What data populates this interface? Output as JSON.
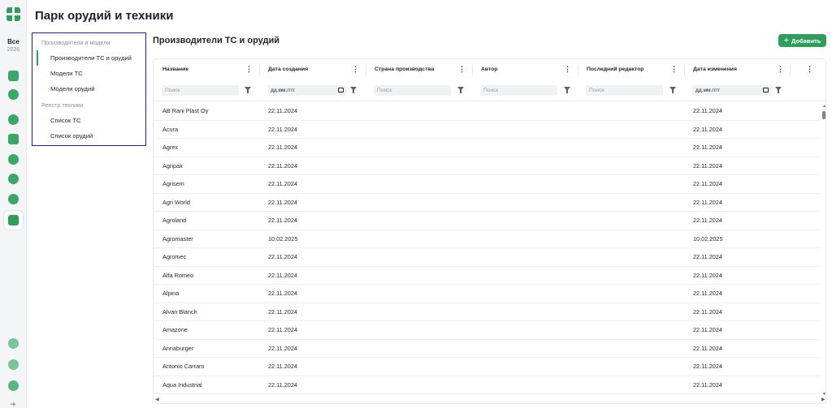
{
  "rail": {
    "year_all": "Все",
    "year": "2026",
    "icons": [
      "dashboard-icon",
      "layers-icon",
      "tractor-icon",
      "clipboard-icon",
      "leaf-icon",
      "sprout-icon",
      "pie-chart-icon",
      "machinery-park-icon",
      "settings-icon",
      "help-icon",
      "profile-icon",
      "logout-icon"
    ]
  },
  "page_title": "Парк орудий и техники",
  "nav": {
    "group1": "Производители и модели",
    "items1": [
      "Производители ТС и орудий",
      "Модели ТС",
      "Модели орудий"
    ],
    "group2": "Реестр техники",
    "items2": [
      "Список ТС",
      "Список орудий"
    ]
  },
  "section_title": "Производители ТС и орудий",
  "add_button": "Добавить",
  "table": {
    "columns": [
      "Название",
      "Дата создания",
      "Страна производства",
      "Автор",
      "Последний редактор",
      "Дата изменения"
    ],
    "filter_placeholder": "Поиск",
    "date_placeholder": "дд.мм.гггг",
    "rows": [
      [
        "AB Rani Plast Oy",
        "22.11.2024",
        "22.11.2024"
      ],
      [
        "Acura",
        "22.11.2024",
        "22.11.2024"
      ],
      [
        "Agrex",
        "22.11.2024",
        "22.11.2024"
      ],
      [
        "Agripak",
        "22.11.2024",
        "22.11.2024"
      ],
      [
        "Agrisem",
        "22.11.2024",
        "22.11.2024"
      ],
      [
        "Agri World",
        "22.11.2024",
        "22.11.2024"
      ],
      [
        "Agroland",
        "22.11.2024",
        "22.11.2024"
      ],
      [
        "Agromaster",
        "10.02.2025",
        "10.02.2025"
      ],
      [
        "Agromec",
        "22.11.2024",
        "22.11.2024"
      ],
      [
        "Alfa Romeo",
        "22.11.2024",
        "22.11.2024"
      ],
      [
        "Alpina",
        "22.11.2024",
        "22.11.2024"
      ],
      [
        "Alvan Blanch",
        "22.11.2024",
        "22.11.2024"
      ],
      [
        "Amazone",
        "22.11.2024",
        "22.11.2024"
      ],
      [
        "Annaburger",
        "22.11.2024",
        "22.11.2024"
      ],
      [
        "Antonio Carraro",
        "22.11.2024",
        "22.11.2024"
      ],
      [
        "Aqua Industrial",
        "22.11.2024",
        "22.11.2024"
      ]
    ]
  },
  "colors": {
    "accent": "#2f9e5a",
    "nav_border": "#1c1ccf"
  }
}
